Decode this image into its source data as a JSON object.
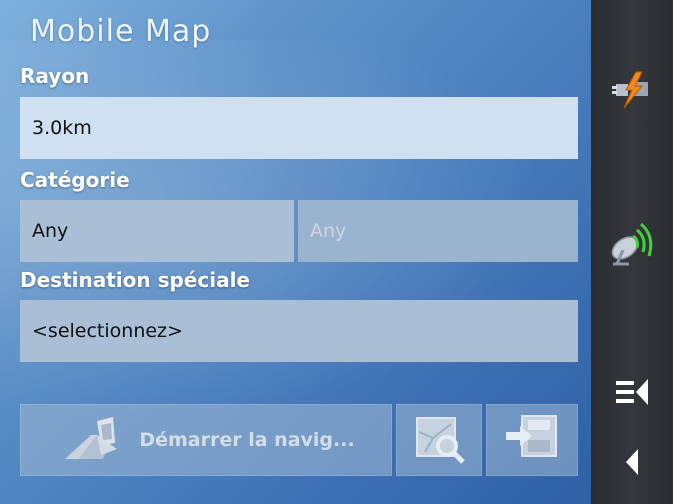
{
  "app": {
    "title": "Mobile  Map"
  },
  "form": {
    "radius_label": "Rayon",
    "radius_value": "3.0km",
    "category_label": "Catégorie",
    "category_value": "Any",
    "subcategory_value": "Any",
    "poi_label": "Destination spéciale",
    "poi_value": "<selectionnez>"
  },
  "actions": {
    "start_navigation_label": "Démarrer la navig..."
  },
  "sidebar": {
    "icons": [
      "power-connector-icon",
      "satellite-dish-icon",
      "menu-icon",
      "back-icon"
    ]
  },
  "colors": {
    "accent_orange": "#f08a1c",
    "signal_green": "#3fd23a",
    "sidebar_bg": "#2f3236"
  }
}
